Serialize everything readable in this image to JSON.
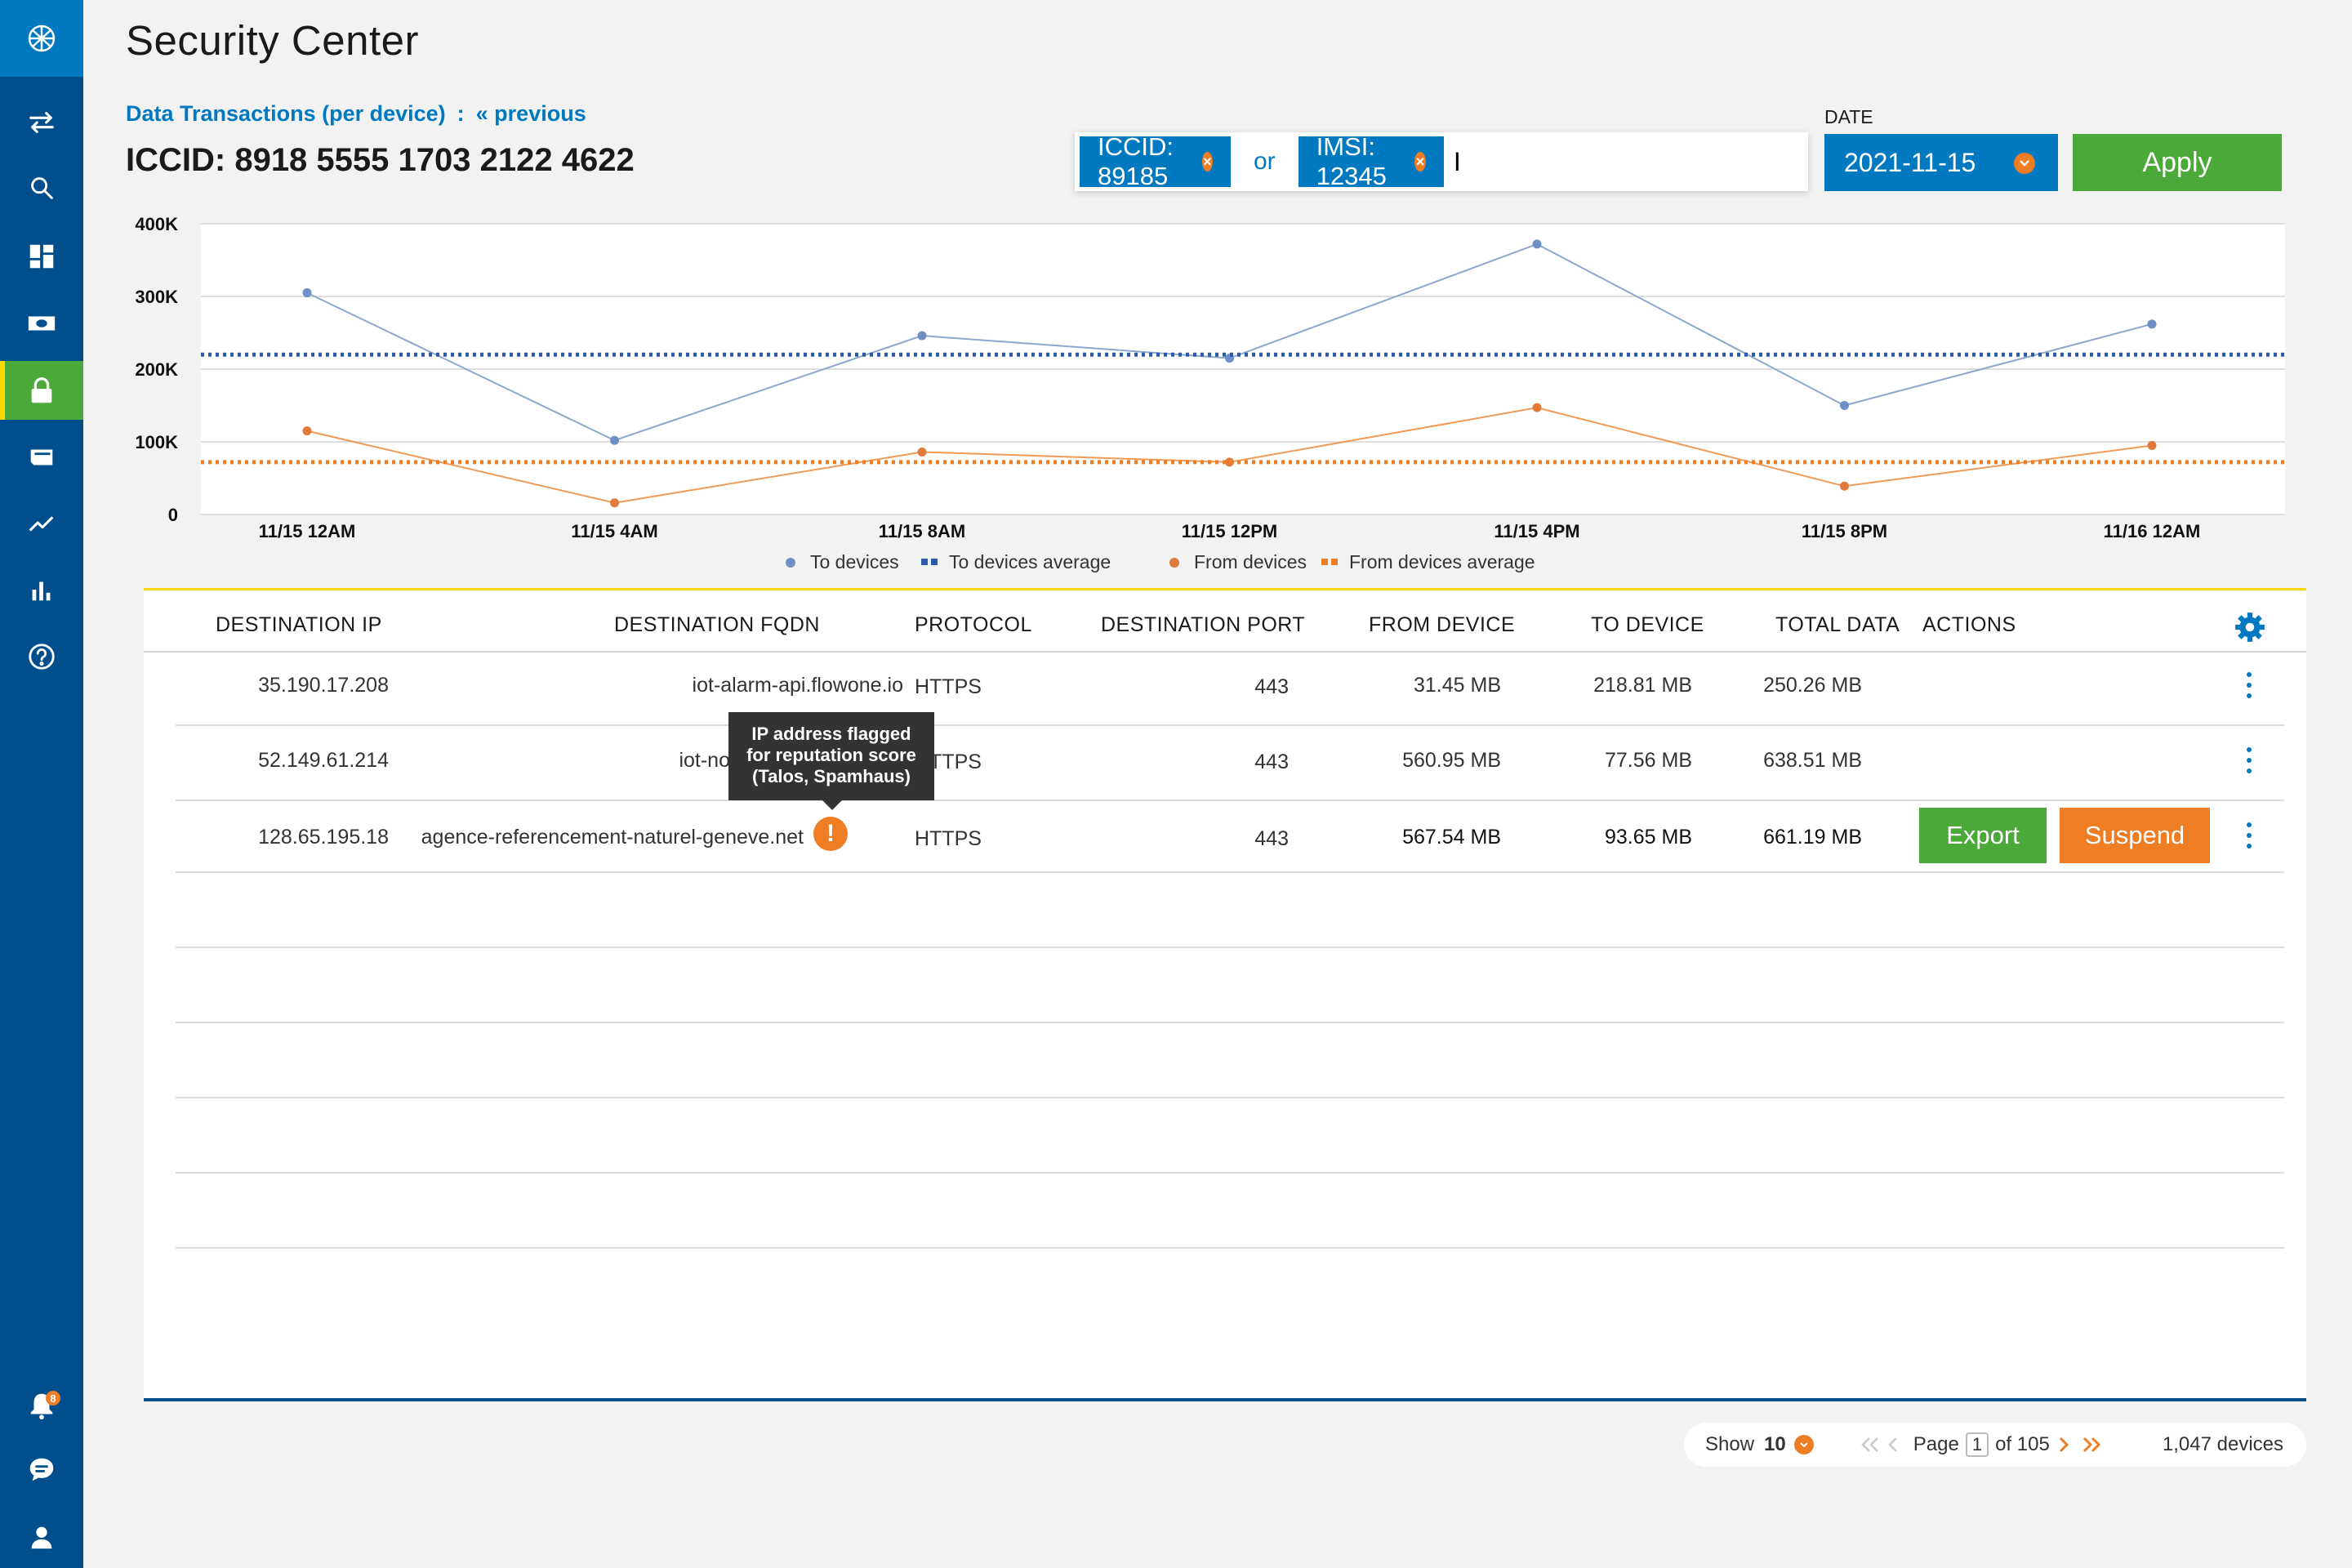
{
  "app": {
    "title": "Security Center"
  },
  "nav": {
    "items": [
      {
        "name": "transfer-icon"
      },
      {
        "name": "search-icon"
      },
      {
        "name": "dashboard-icon"
      },
      {
        "name": "sim-card-icon"
      },
      {
        "name": "lock-icon",
        "active": true
      },
      {
        "name": "card-icon"
      },
      {
        "name": "trend-icon"
      },
      {
        "name": "bar-chart-icon"
      },
      {
        "name": "help-icon"
      }
    ],
    "bottom": [
      {
        "name": "bell-icon",
        "badge": "8"
      },
      {
        "name": "chat-icon"
      },
      {
        "name": "user-icon"
      }
    ]
  },
  "header": {
    "section_label": "Data Transactions (per device)",
    "separator": ":",
    "previous_link": "« previous",
    "device_id": "ICCID: 8918 5555 1703 2122 4622"
  },
  "search": {
    "chips": [
      "ICCID: 89185",
      "IMSI: 12345"
    ],
    "joiner": "or",
    "value": "I",
    "placeholder": ""
  },
  "date": {
    "label": "DATE",
    "value": "2021-11-15"
  },
  "apply_label": "Apply",
  "colors": {
    "primary": "#0079c1",
    "sidebar": "#004f8c",
    "green": "#4ba93a",
    "orange": "#ef7d23",
    "yellow": "#fed700",
    "to_series": "#8fa6cf",
    "from_series": "#f09a56"
  },
  "chart_data": {
    "type": "line",
    "x": [
      "11/15 12AM",
      "11/15 4AM",
      "11/15 8AM",
      "11/15 12PM",
      "11/15 4PM",
      "11/15 8PM",
      "11/16 12AM"
    ],
    "y_ticks": [
      "0",
      "100K",
      "200K",
      "300K",
      "400K"
    ],
    "ylim": [
      0,
      400000
    ],
    "grid": true,
    "legend_position": "bottom",
    "series": [
      {
        "name": "To devices",
        "style": "line-dot",
        "values": [
          305000,
          102000,
          246000,
          215000,
          372000,
          150000,
          262000
        ]
      },
      {
        "name": "To devices average",
        "style": "dotted",
        "values": [
          220000,
          220000,
          220000,
          220000,
          220000,
          220000,
          220000
        ]
      },
      {
        "name": "From devices",
        "style": "line-dot",
        "values": [
          115000,
          16000,
          86000,
          72000,
          147000,
          39000,
          95000
        ]
      },
      {
        "name": "From devices average",
        "style": "dotted",
        "values": [
          72000,
          72000,
          72000,
          72000,
          72000,
          72000,
          72000
        ]
      }
    ]
  },
  "table": {
    "headers": [
      "DESTINATION IP",
      "DESTINATION FQDN",
      "PROTOCOL",
      "DESTINATION PORT",
      "FROM DEVICE",
      "TO DEVICE",
      "TOTAL DATA",
      "ACTIONS"
    ],
    "rows": [
      {
        "ip": "35.190.17.208",
        "fqdn": "iot-alarm-api.flowone.io",
        "protocol": "HTTPS",
        "port": "443",
        "from": "31.45 MB",
        "to": "218.81 MB",
        "total": "250.26 MB"
      },
      {
        "ip": "52.149.61.214",
        "fqdn": "iot-now.com.admin-eu",
        "protocol": "HTTPS",
        "port": "443",
        "from": "560.95 MB",
        "to": "77.56 MB",
        "total": "638.51 MB"
      },
      {
        "ip": "128.65.195.18",
        "fqdn": "agence-referencement-naturel-geneve.net",
        "protocol": "HTTPS",
        "port": "443",
        "from": "567.54 MB",
        "to": "93.65 MB",
        "total": "661.19 MB",
        "flagged": true
      }
    ],
    "export_label": "Export",
    "suspend_label": "Suspend",
    "tooltip": [
      "IP address flagged",
      "for reputation score",
      "(Talos, Spamhaus)"
    ]
  },
  "pager": {
    "show_label": "Show",
    "page_size": "10",
    "page_label": "Page",
    "page": "1",
    "of_label": "of 105",
    "total": "1,047 devices"
  }
}
